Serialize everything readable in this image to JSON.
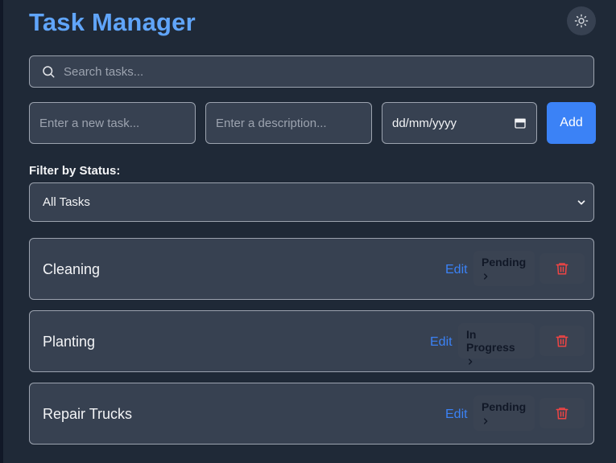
{
  "header": {
    "title": "Task Manager",
    "theme_icon": "sun-icon"
  },
  "search": {
    "placeholder": "Search tasks..."
  },
  "new_task": {
    "title_placeholder": "Enter a new task...",
    "description_placeholder": "Enter a description...",
    "date_placeholder": "dd/mm/yyyy",
    "add_label": "Add"
  },
  "filter": {
    "label": "Filter by Status:",
    "selected": "All Tasks"
  },
  "tasks": [
    {
      "title": "Cleaning",
      "edit_label": "Edit",
      "status": "Pending"
    },
    {
      "title": "Planting",
      "edit_label": "Edit",
      "status": "In Progress"
    },
    {
      "title": "Repair Trucks",
      "edit_label": "Edit",
      "status": "Pending"
    }
  ],
  "colors": {
    "accent": "#3b82f6",
    "title": "#60a5fa",
    "delete": "#ef4444",
    "background": "#1f2937",
    "card": "#374151"
  }
}
